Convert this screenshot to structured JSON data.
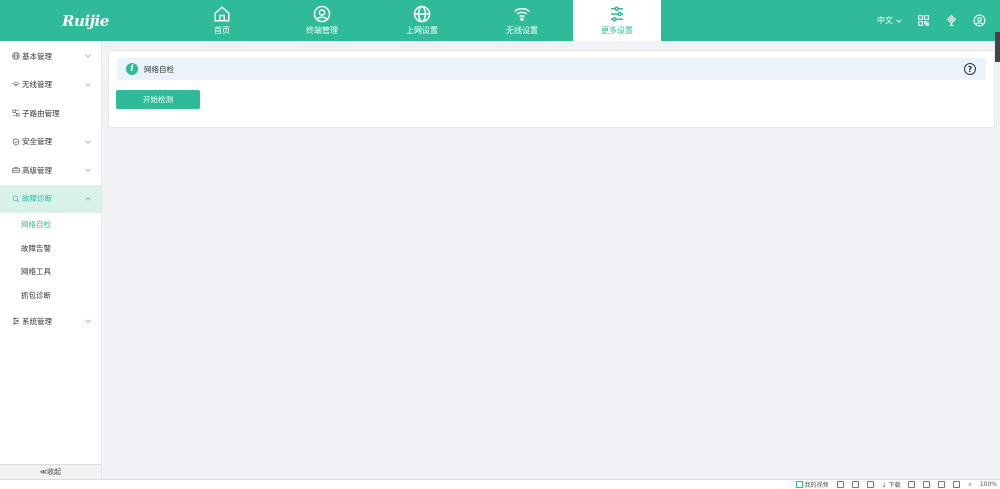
{
  "header": {
    "logo": "Ruijie",
    "nav": [
      {
        "label": "首页",
        "icon": "home-icon"
      },
      {
        "label": "终端管理",
        "icon": "user-circle-icon"
      },
      {
        "label": "上网设置",
        "icon": "globe-icon"
      },
      {
        "label": "无线设置",
        "icon": "wifi-icon"
      },
      {
        "label": "更多设置",
        "icon": "sliders-icon",
        "active": true
      }
    ],
    "language": "中文",
    "right_icons": [
      "qrcode-icon",
      "bell-icon",
      "account-icon"
    ]
  },
  "sidebar": {
    "items": [
      {
        "label": "基本管理",
        "icon": "globe-icon"
      },
      {
        "label": "无线管理",
        "icon": "wifi-icon"
      },
      {
        "label": "子路由管理",
        "icon": "sub-router-icon"
      },
      {
        "label": "安全管理",
        "icon": "shield-icon"
      },
      {
        "label": "高级管理",
        "icon": "advanced-icon"
      },
      {
        "label": "故障诊断",
        "icon": "search-icon",
        "active": true
      },
      {
        "label": "系统管理",
        "icon": "system-icon"
      }
    ],
    "sub_items": [
      {
        "label": "网络自检",
        "active": true
      },
      {
        "label": "故障告警"
      },
      {
        "label": "网络工具"
      },
      {
        "label": "抓包诊断"
      }
    ],
    "collapse_label": "≪收起"
  },
  "main": {
    "panel_title": "网络自检",
    "start_button": "开始检测",
    "help_icon": "help-icon",
    "info_icon": "info-icon"
  },
  "statusbar": {
    "video": "我的视频",
    "download": "下载",
    "zoom": "100%"
  },
  "colors": {
    "accent": "#2fbb99",
    "info_bg": "#eaf3fb",
    "menu_active_bg": "#d8f2eb"
  }
}
